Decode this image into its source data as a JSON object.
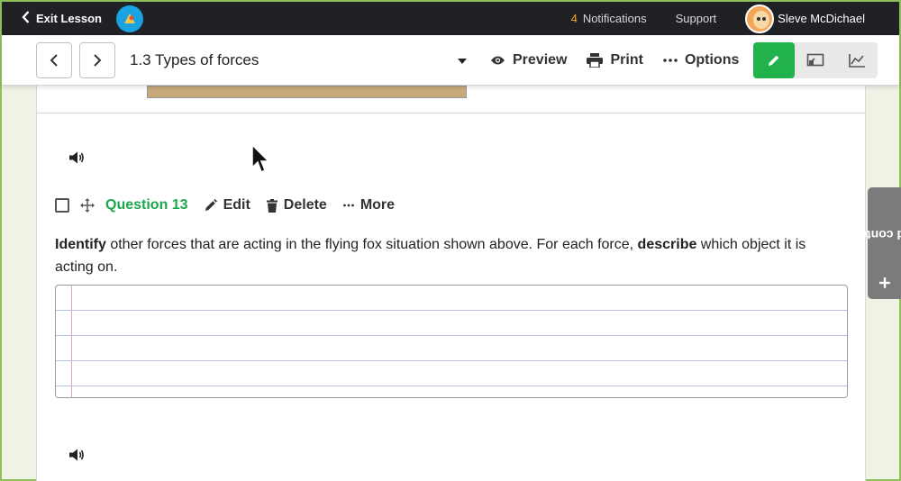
{
  "topbar": {
    "exit_label": "Exit Lesson",
    "notifications_count": "4",
    "notifications_label": "Notifications",
    "support_label": "Support",
    "user_name": "Sleve McDichael"
  },
  "toolbar": {
    "lesson_title": "1.3 Types of forces",
    "preview_label": "Preview",
    "print_label": "Print",
    "options_label": "Options",
    "mode_active_color": "#22b24c"
  },
  "question": {
    "label": "Question 13",
    "edit_label": "Edit",
    "delete_label": "Delete",
    "more_label": "More",
    "prompt_bold_1": "Identify",
    "prompt_text_1": " other forces that are acting in the flying fox situation shown above. For each force, ",
    "prompt_bold_2": "describe",
    "prompt_text_2": " which object it is acting on."
  },
  "side_tab": {
    "label": "Add content"
  },
  "colors": {
    "accent_green": "#1ca84a",
    "topbar_bg": "#1f2124",
    "notification_count": "#f5a623"
  }
}
